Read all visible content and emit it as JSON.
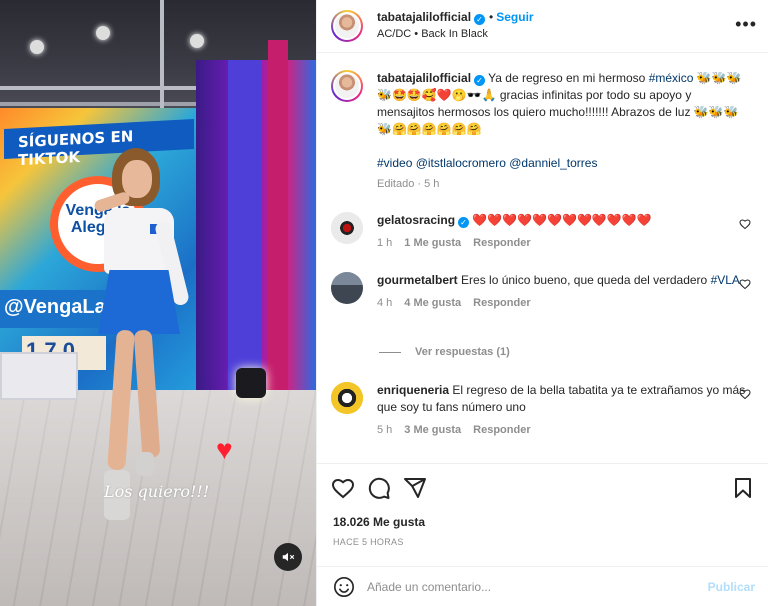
{
  "media": {
    "banner_text": "SÍGUENOS EN TIKTOK",
    "show_logo_text": "Venga la Alegría",
    "handle_text": "@VengaLa",
    "digits_text": "1,7 0",
    "overlay_caption": "Los quiero!!!",
    "heart_glyph": "♥",
    "mute_icon": "volume-muted-icon"
  },
  "header": {
    "username": "tabatajalilofficial",
    "verified_glyph": "✓",
    "separator": "•",
    "follow_label": "Seguir",
    "song": "AC/DC • Back In Black",
    "more_label": "•••"
  },
  "caption": {
    "username": "tabatajalilofficial",
    "text_intro": "Ya de regreso en mi hermoso",
    "hashtag_mexico": "#méxico",
    "emojis_1": "🐝🐝🐝🐝🤩🤩🥰❤️🫢🕶️🙏",
    "text_body": "gracias infinitas por todo su apoyo y mensajitos hermosos los quiero mucho!!!!!!! Abrazos de luz",
    "emojis_2": "🐝🐝🐝🐝🤗🤗🤗🤗🤗🤗",
    "tags": "#video @itstlalocromero @danniel_torres",
    "edited": "Editado · 5 h"
  },
  "comments": [
    {
      "username": "gelatosracing",
      "verified": true,
      "text": "❤️❤️❤️❤️❤️❤️❤️❤️❤️❤️❤️❤️",
      "time": "1 h",
      "likes": "1 Me gusta",
      "reply": "Responder"
    },
    {
      "username": "gourmetalbert",
      "verified": false,
      "text": "Eres lo único bueno, que queda del verdadero",
      "hashtag": "#VLA",
      "time": "4 h",
      "likes": "4 Me gusta",
      "reply": "Responder",
      "view_replies": "Ver respuestas (1)"
    },
    {
      "username": "enriqueneria",
      "verified": false,
      "text": "El regreso de la bella tabatita ya te extrañamos yo más que soy tu fans número uno",
      "time": "5 h",
      "likes": "3 Me gusta",
      "reply": "Responder"
    }
  ],
  "actions": {
    "like_icon": "heart-icon",
    "comment_icon": "comment-icon",
    "share_icon": "share-icon",
    "save_icon": "bookmark-icon",
    "likes_count": "18.026 Me gusta",
    "posted": "HACE 5 HORAS"
  },
  "composer": {
    "placeholder": "Añade un comentario...",
    "publish_label": "Publicar",
    "emoji_icon": "smiley-icon"
  },
  "colors": {
    "link_blue": "#0095f6",
    "hashtag": "#00376b",
    "muted": "#8e8e8e",
    "heart_red": "#ed4956"
  }
}
